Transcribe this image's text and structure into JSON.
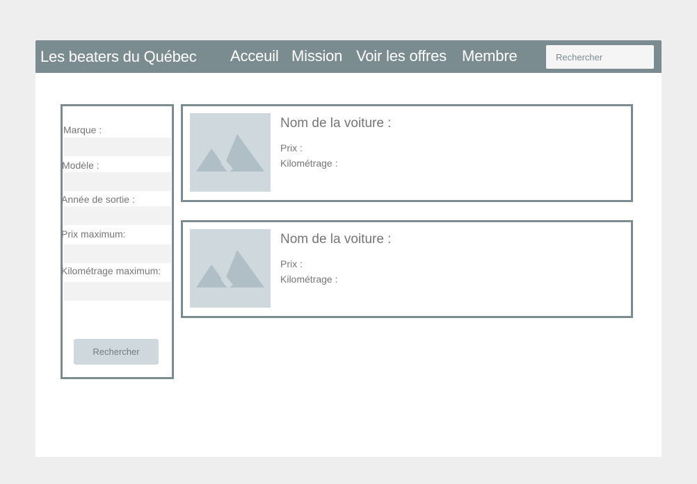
{
  "navbar": {
    "brand": "Les beaters du Québec",
    "links": [
      "Acceuil",
      "Mission",
      "Voir les offres",
      "Membre"
    ],
    "search_placeholder": "Rechercher"
  },
  "filters": {
    "marque_label": "Marque :",
    "modele_label": "Modèle :",
    "annee_label": "Année de sortie :",
    "prix_label": "Prix maximum:",
    "km_label": "Kilométrage maximum:",
    "button_label": "Rechercher"
  },
  "cards": [
    {
      "name_label": "Nom de la voiture :",
      "price_label": "Prix :",
      "km_label": "Kilométrage :"
    },
    {
      "name_label": "Nom de la voiture :",
      "price_label": "Prix :",
      "km_label": "Kilométrage :"
    }
  ],
  "colors": {
    "navbar": "#7a8c90",
    "border": "#7a8c90",
    "image_placeholder": "#cfd8dc",
    "image_icon": "#b0bec5",
    "field_background": "#f2f2f2",
    "text": "#757575"
  }
}
